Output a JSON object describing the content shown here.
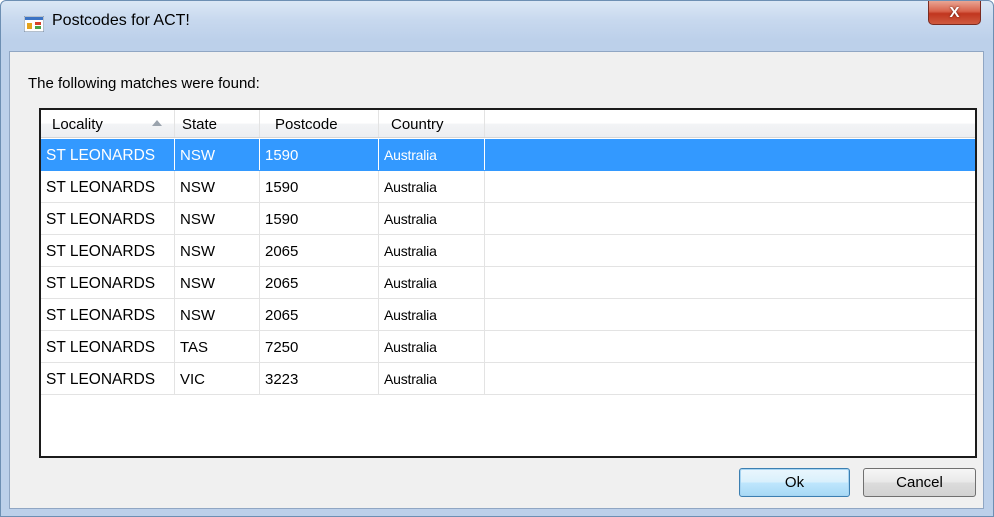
{
  "window": {
    "title": "Postcodes for ACT!",
    "close_glyph": "X",
    "icon": "app-window-icon"
  },
  "prompt": "The following matches were found:",
  "columns": [
    {
      "label": "Locality",
      "sorted": "ascending"
    },
    {
      "label": "State"
    },
    {
      "label": "Postcode"
    },
    {
      "label": "Country"
    }
  ],
  "rows": [
    {
      "locality": "ST LEONARDS",
      "state": "NSW",
      "postcode": "1590",
      "country": "Australia",
      "selected": true
    },
    {
      "locality": "ST LEONARDS",
      "state": "NSW",
      "postcode": "1590",
      "country": "Australia"
    },
    {
      "locality": "ST LEONARDS",
      "state": "NSW",
      "postcode": "1590",
      "country": "Australia"
    },
    {
      "locality": "ST LEONARDS",
      "state": "NSW",
      "postcode": "2065",
      "country": "Australia"
    },
    {
      "locality": "ST LEONARDS",
      "state": "NSW",
      "postcode": "2065",
      "country": "Australia"
    },
    {
      "locality": "ST LEONARDS",
      "state": "NSW",
      "postcode": "2065",
      "country": "Australia"
    },
    {
      "locality": "ST LEONARDS",
      "state": "TAS",
      "postcode": "7250",
      "country": "Australia"
    },
    {
      "locality": "ST LEONARDS",
      "state": "VIC",
      "postcode": "3223",
      "country": "Australia"
    }
  ],
  "buttons": {
    "ok": "Ok",
    "cancel": "Cancel"
  },
  "colors": {
    "selection": "#3399ff",
    "frame": "#bcd0ea",
    "close": "#c1361f"
  }
}
